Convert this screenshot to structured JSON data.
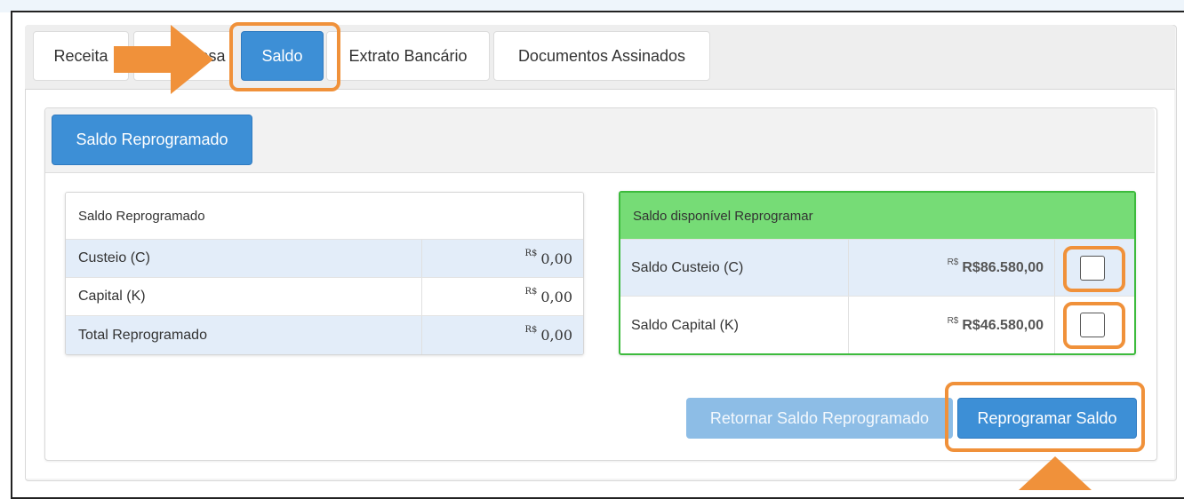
{
  "tabs": [
    {
      "label": "Receita"
    },
    {
      "label": "Despesa"
    },
    {
      "label": "Saldo"
    },
    {
      "label": "Extrato Bancário"
    },
    {
      "label": "Documentos Assinados"
    }
  ],
  "section_button": "Saldo Reprogramado",
  "left_table": {
    "header": "Saldo Reprogramado",
    "currency_symbol": "R$",
    "rows": [
      {
        "label": "Custeio (C)",
        "value": "0,00"
      },
      {
        "label": "Capital (K)",
        "value": "0,00"
      },
      {
        "label": "Total Reprogramado",
        "value": "0,00"
      }
    ]
  },
  "right_table": {
    "header": "Saldo disponível Reprogramar",
    "currency_symbol": "R$",
    "rows": [
      {
        "label": "Saldo Custeio (C)",
        "value": "R$86.580,00",
        "checked": false
      },
      {
        "label": "Saldo Capital (K)",
        "value": "R$46.580,00",
        "checked": false
      }
    ]
  },
  "buttons": {
    "retornar": "Retornar Saldo Reprogramado",
    "reprogramar": "Reprogramar Saldo"
  },
  "colors": {
    "primary": "#3d8fd6",
    "success_header": "#76dc76",
    "success_border": "#3dbb3d",
    "highlight": "#f0913a"
  },
  "icons": [
    "pointer-arrow",
    "checkbox"
  ]
}
